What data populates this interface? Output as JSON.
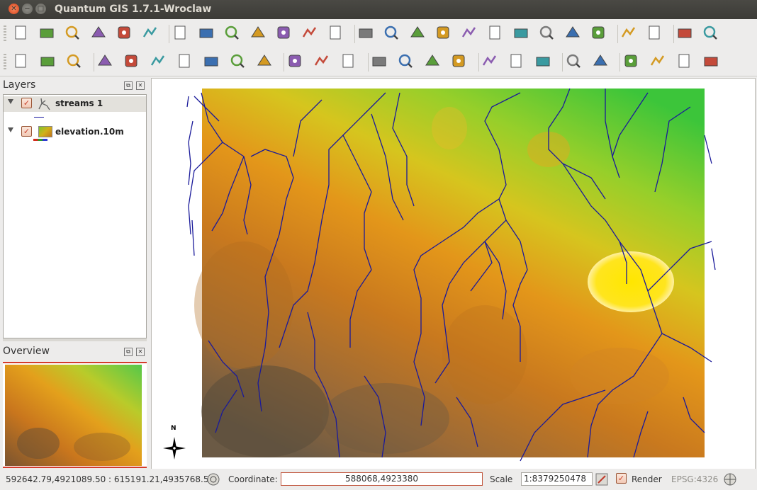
{
  "window": {
    "title": "Quantum GIS 1.7.1-Wroclaw",
    "close_glyph": "✕",
    "minimize_glyph": "−",
    "maximize_glyph": "□"
  },
  "toolbar1": {
    "icons": [
      "new-project-icon",
      "open-project-icon",
      "save-project-icon",
      "save-as-icon",
      "print-composer-icon",
      "print-icon",
      "add-vector-layer-icon",
      "add-raster-layer-icon",
      "add-postgis-layer-icon",
      "add-spatialite-layer-icon",
      "add-wms-layer-icon",
      "new-shapefile-icon",
      "remove-layer-icon",
      "pan-icon",
      "zoom-in-icon",
      "zoom-out-icon",
      "zoom-full-icon",
      "zoom-to-selection-icon",
      "zoom-to-layer-icon",
      "zoom-native-icon",
      "zoom-last-icon",
      "zoom-next-icon",
      "refresh-icon",
      "identify-icon",
      "whats-this-icon",
      "grass-module-icon",
      "histogram-icon"
    ]
  },
  "toolbar2": {
    "icons": [
      "add-grass-vector-icon",
      "add-grass-raster-icon",
      "remove-grass-icon",
      "add-feature-icon",
      "add-ring-icon",
      "delete-ring-icon",
      "edit-pencil-icon",
      "node-tool-icon",
      "copy-features-icon",
      "paste-features-icon",
      "georeferencer-icon",
      "gps-tool-icon",
      "north-arrow-icon",
      "label-icon",
      "vertex-tool-icon",
      "move-label-icon",
      "rotate-label-icon",
      "select-icon",
      "select-by-rectangle-icon",
      "deselect-icon",
      "attribute-table-icon",
      "measure-line-icon",
      "annotation-icon",
      "home-icon",
      "home-alt-icon",
      "text-annotation-icon"
    ]
  },
  "layers_panel": {
    "title": "Layers",
    "float_glyph": "⧉",
    "close_glyph": "✕",
    "layers": [
      {
        "name": "streams 1",
        "checked": true,
        "icon": "vector-line-icon",
        "legend_color": "#1a1aa0"
      },
      {
        "name": "elevation.10m",
        "checked": true,
        "icon": "raster-layer-icon"
      }
    ]
  },
  "overview_panel": {
    "title": "Overview",
    "float_glyph": "⧉",
    "close_glyph": "✕"
  },
  "map": {
    "north_arrow_label": "N",
    "stream_color": "#1a1a9a",
    "highlight_color": "#ffee22"
  },
  "status_bar": {
    "extent": "592642.79,4921089.50 : 615191.21,4935768.50",
    "coordinate_label": "Coordinate:",
    "coordinate_value": "588068,4923380",
    "scale_label": "Scale",
    "scale_value": "1:8379250478",
    "render_label": "Render",
    "render_checked": true,
    "crs": "EPSG:4326"
  }
}
